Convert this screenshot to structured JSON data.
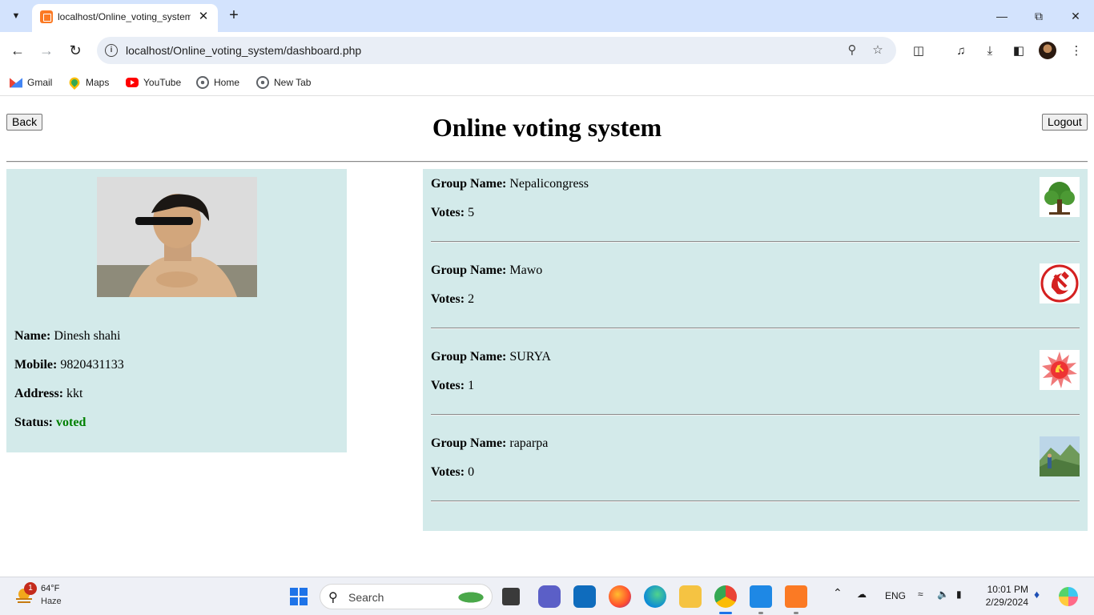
{
  "browser": {
    "tab_title": "localhost/Online_voting_system",
    "url": "localhost/Online_voting_system/dashboard.php",
    "bookmarks": [
      {
        "label": "Gmail",
        "icon": "gmail-icon"
      },
      {
        "label": "Maps",
        "icon": "maps-icon"
      },
      {
        "label": "YouTube",
        "icon": "youtube-icon"
      },
      {
        "label": "Home",
        "icon": "globe-icon"
      },
      {
        "label": "New Tab",
        "icon": "globe-icon"
      }
    ]
  },
  "page": {
    "title": "Online voting system",
    "back_label": "Back",
    "logout_label": "Logout",
    "card_color": "#d3eaea"
  },
  "user": {
    "name_label": "Name:",
    "name": "Dinesh shahi",
    "mobile_label": "Mobile:",
    "mobile": "9820431133",
    "address_label": "Address:",
    "address": "kkt",
    "status_label": "Status:",
    "status": "voted",
    "status_color": "#008000"
  },
  "groups": [
    {
      "name_label": "Group Name:",
      "name": "Nepalicongress",
      "votes_label": "Votes:",
      "votes": "5",
      "symbol": "tree-symbol"
    },
    {
      "name_label": "Group Name:",
      "name": "Mawo",
      "votes_label": "Votes:",
      "votes": "2",
      "symbol": "hammer-sickle-symbol"
    },
    {
      "name_label": "Group Name:",
      "name": "SURYA",
      "votes_label": "Votes:",
      "votes": "1",
      "symbol": "sun-symbol"
    },
    {
      "name_label": "Group Name:",
      "name": "raparpa",
      "votes_label": "Votes:",
      "votes": "0",
      "symbol": "landscape-photo"
    }
  ],
  "taskbar": {
    "weather_badge": "1",
    "temperature": "64°F",
    "condition": "Haze",
    "search_placeholder": "Search",
    "language": "ENG",
    "time": "10:01 PM",
    "date": "2/29/2024"
  }
}
